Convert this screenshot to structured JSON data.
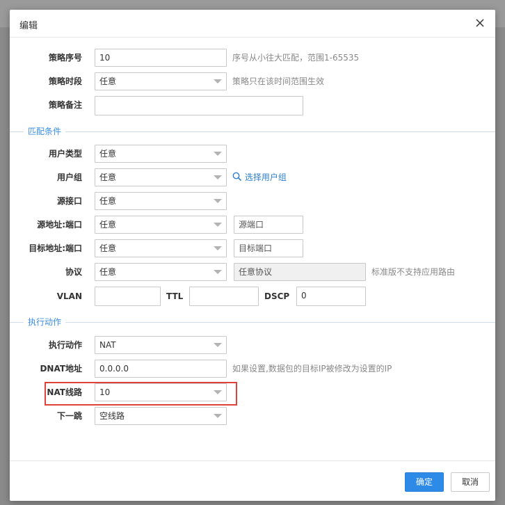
{
  "dialog": {
    "title": "编辑",
    "confirm_label": "确定",
    "cancel_label": "取消"
  },
  "policy": {
    "seq_label": "策略序号",
    "seq_value": "10",
    "seq_hint": "序号从小往大匹配，范围1-65535",
    "time_label": "策略时段",
    "time_value": "任意",
    "time_hint": "策略只在该时间范围生效",
    "note_label": "策略备注",
    "note_value": ""
  },
  "match": {
    "section_title": "匹配条件",
    "user_type_label": "用户类型",
    "user_type_value": "任意",
    "user_group_label": "用户组",
    "user_group_value": "任意",
    "user_group_link": "选择用户组",
    "src_iface_label": "源接口",
    "src_iface_value": "任意",
    "src_addr_label": "源地址:端口",
    "src_addr_value": "任意",
    "src_port_placeholder": "源端口",
    "dst_addr_label": "目标地址:端口",
    "dst_addr_value": "任意",
    "dst_port_placeholder": "目标端口",
    "protocol_label": "协议",
    "protocol_value": "任意",
    "app_protocol_placeholder": "任意协议",
    "protocol_hint": "标准版不支持应用路由",
    "vlan_label": "VLAN",
    "vlan_value": "",
    "ttl_label": "TTL",
    "ttl_value": "",
    "dscp_label": "DSCP",
    "dscp_value": "0"
  },
  "action": {
    "section_title": "执行动作",
    "action_label": "执行动作",
    "action_value": "NAT",
    "dnat_label": "DNAT地址",
    "dnat_value": "0.0.0.0",
    "dnat_hint": "如果设置,数据包的目标IP被修改为设置的IP",
    "nat_line_label": "NAT线路",
    "nat_line_value": "10",
    "next_hop_label": "下一跳",
    "next_hop_value": "空线路"
  },
  "colors": {
    "accent": "#2d8ae6",
    "section": "#3a8ee6",
    "highlight": "#e0413a"
  }
}
